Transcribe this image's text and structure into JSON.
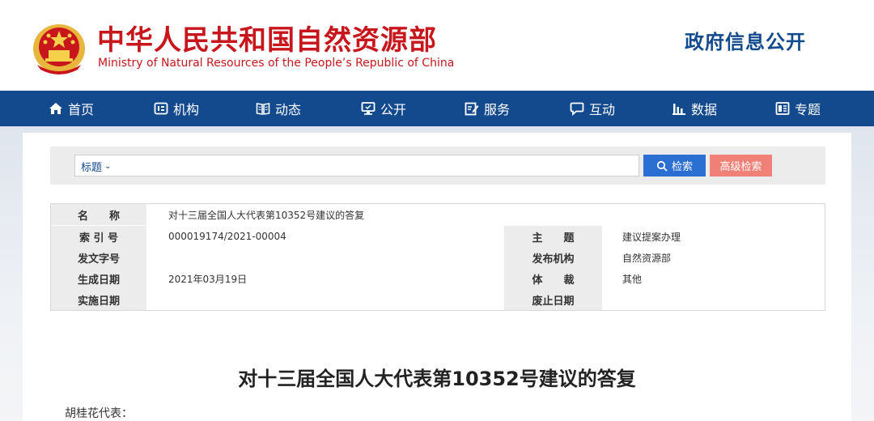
{
  "header": {
    "title_cn": "中华人民共和国自然资源部",
    "title_en": "Ministry of Natural Resources of the People’s Republic of China",
    "gov_info_open": "政府信息公开",
    "emblem_icon": "national-emblem-icon"
  },
  "nav": {
    "items": [
      {
        "label": "首页",
        "icon": "home-icon"
      },
      {
        "label": "机构",
        "icon": "organization-icon"
      },
      {
        "label": "动态",
        "icon": "book-icon"
      },
      {
        "label": "公开",
        "icon": "monitor-icon"
      },
      {
        "label": "服务",
        "icon": "edit-icon"
      },
      {
        "label": "互动",
        "icon": "chat-icon"
      },
      {
        "label": "数据",
        "icon": "bar-chart-icon"
      },
      {
        "label": "专题",
        "icon": "topic-icon"
      }
    ]
  },
  "search": {
    "category": "标题",
    "placeholder": "",
    "search_button": "检索",
    "advanced_button": "高级检索"
  },
  "meta": {
    "name_label": "名　　称",
    "name_value": "对十三届全国人大代表第10352号建议的答复",
    "index_label": "索 引 号",
    "index_value": "000019174/2021-00004",
    "subject_label": "主　　题",
    "subject_value": "建议提案办理",
    "doc_no_label": "发文字号",
    "doc_no_value": "",
    "issuer_label": "发布机构",
    "issuer_value": "自然资源部",
    "created_label": "生成日期",
    "created_value": "2021年03月19日",
    "genre_label": "体　　裁",
    "genre_value": "其他",
    "effective_label": "实施日期",
    "effective_value": "",
    "expire_label": "废止日期",
    "expire_value": ""
  },
  "article": {
    "title": "对十三届全国人大代表第10352号建议的答复",
    "greeting": "胡桂花代表："
  },
  "colors": {
    "brand_red": "#c8161d",
    "nav_blue": "#134a8e",
    "search_blue": "#2a6fd1",
    "advanced_red": "#f08078"
  }
}
